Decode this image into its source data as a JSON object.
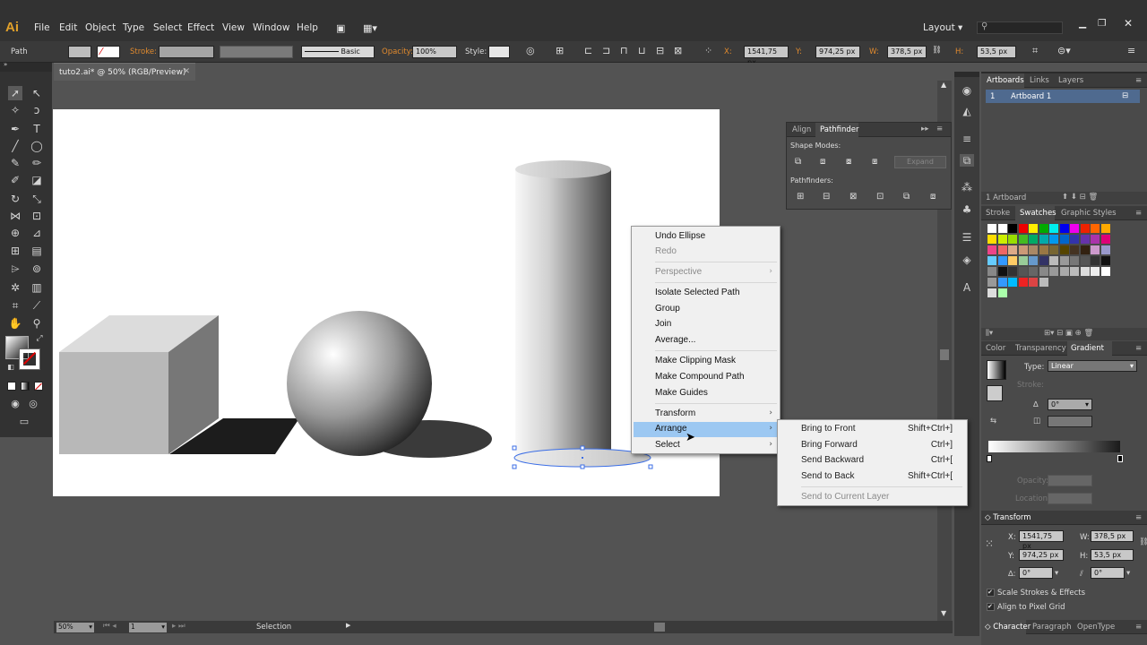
{
  "app": {
    "logo": "Ai",
    "layout": "Layout"
  },
  "menu": [
    "File",
    "Edit",
    "Object",
    "Type",
    "Select",
    "Effect",
    "View",
    "Window",
    "Help"
  ],
  "control_bar": {
    "selection_type": "Path",
    "stroke_label": "Stroke:",
    "brush": "Basic",
    "opacity_label": "Opacity:",
    "opacity": "100%",
    "style_label": "Style:",
    "x_label": "X:",
    "x": "1541,75 px",
    "y_label": "Y:",
    "y": "974,25 px",
    "w_label": "W:",
    "w": "378,5 px",
    "h_label": "H:",
    "h": "53,5 px"
  },
  "document": {
    "tab": "tuto2.ai* @ 50% (RGB/Preview)"
  },
  "status": {
    "zoom": "50%",
    "page": "1",
    "mode": "Selection"
  },
  "pathfinder_panel": {
    "tabs": [
      "Align",
      "Pathfinder"
    ],
    "shape_modes": "Shape Modes:",
    "expand": "Expand",
    "pathfinders": "Pathfinders:"
  },
  "artboards_panel": {
    "tabs": [
      "Artboards",
      "Links",
      "Layers"
    ],
    "row_num": "1",
    "row_name": "Artboard 1",
    "count": "1 Artboard"
  },
  "swatches_panel": {
    "tabs": [
      "Stroke",
      "Swatches",
      "Graphic Styles"
    ]
  },
  "gradient_panel": {
    "tabs": [
      "Color",
      "Transparency",
      "Gradient"
    ],
    "type_label": "Type:",
    "type": "Linear",
    "stroke_label": "Stroke:",
    "angle": "0°",
    "opacity_label": "Opacity:",
    "location_label": "Location:"
  },
  "transform_panel": {
    "title": "Transform",
    "x_label": "X:",
    "x": "1541,75 px",
    "y_label": "Y:",
    "y": "974,25 px",
    "w_label": "W:",
    "w": "378,5 px",
    "h_label": "H:",
    "h": "53,5 px",
    "rot": "0°",
    "shear": "0°",
    "scale_strokes": "Scale Strokes & Effects",
    "align_pixel": "Align to Pixel Grid"
  },
  "bottom_tabs": [
    "Character",
    "Paragraph",
    "OpenType"
  ],
  "context_menu": {
    "items": {
      "undo": "Undo Ellipse",
      "redo": "Redo",
      "perspective": "Perspective",
      "isolate": "Isolate Selected Path",
      "group": "Group",
      "join": "Join",
      "average": "Average...",
      "clip": "Make Clipping Mask",
      "compound": "Make Compound Path",
      "guides": "Make Guides",
      "transform": "Transform",
      "arrange": "Arrange",
      "select": "Select"
    }
  },
  "arrange_submenu": {
    "front": "Bring to Front",
    "front_sc": "Shift+Ctrl+]",
    "forward": "Bring Forward",
    "forward_sc": "Ctrl+]",
    "backward": "Send Backward",
    "backward_sc": "Ctrl+[",
    "back": "Send to Back",
    "back_sc": "Shift+Ctrl+[",
    "layer": "Send to Current Layer"
  }
}
